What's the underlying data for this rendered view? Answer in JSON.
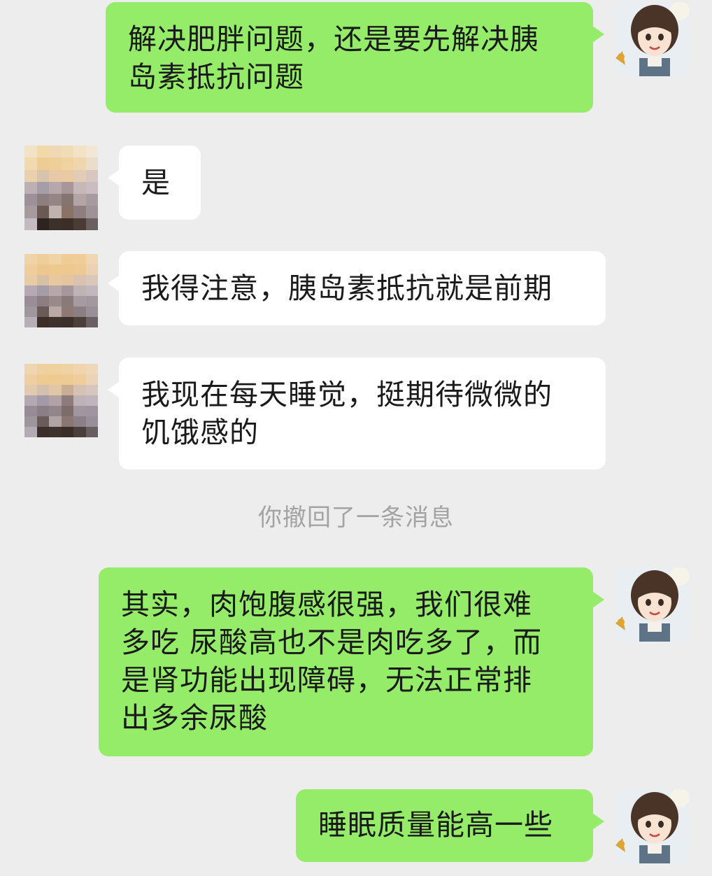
{
  "messages": [
    {
      "id": "m1",
      "side": "outgoing",
      "lines": [
        "解决肥胖问题，还是要先解决胰",
        "岛素抵抗问题"
      ]
    },
    {
      "id": "m2",
      "side": "incoming",
      "lines": [
        "是"
      ]
    },
    {
      "id": "m3",
      "side": "incoming",
      "lines": [
        "我得注意，胰岛素抵抗就是前期"
      ]
    },
    {
      "id": "m4",
      "side": "incoming",
      "lines": [
        "我现在每天睡觉，挺期待微微的",
        "饥饿感的"
      ]
    },
    {
      "id": "m5",
      "side": "outgoing",
      "lines": [
        "其实，肉饱腹感很强，我们很难",
        "多吃 尿酸高也不是肉吃多了，而",
        "是肾功能出现障碍，无法正常排",
        "出多余尿酸"
      ]
    },
    {
      "id": "m6",
      "side": "outgoing",
      "lines": [
        "睡眠质量能高一些"
      ]
    }
  ],
  "system_notice": "你撤回了一条消息",
  "colors": {
    "background": "#EDEDED",
    "outgoing_bubble": "#95EC69",
    "incoming_bubble": "#FFFFFF",
    "system_text": "#A3A3A3"
  },
  "icons": {
    "self_avatar": "cartoon-girl-avatar-icon",
    "contact_avatar": "pixelated-avatar-icon"
  }
}
